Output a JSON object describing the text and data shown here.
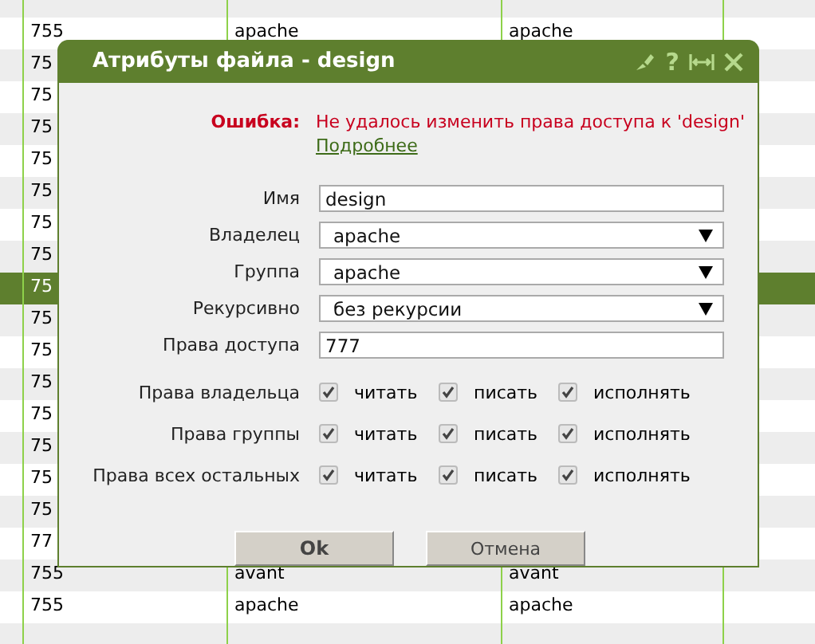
{
  "table": {
    "rows": [
      {
        "column_1": "755",
        "column_2": "apache",
        "column_3": "apache",
        "selected": false
      },
      {
        "column_1": "75",
        "selected": false
      },
      {
        "column_1": "75",
        "selected": false
      },
      {
        "column_1": "75",
        "selected": false
      },
      {
        "column_1": "75",
        "selected": false
      },
      {
        "column_1": "75",
        "selected": false
      },
      {
        "column_1": "75",
        "selected": false
      },
      {
        "column_1": "75",
        "selected": false
      },
      {
        "column_1": "75",
        "selected": true
      },
      {
        "column_1": "75",
        "selected": false
      },
      {
        "column_1": "75",
        "selected": false
      },
      {
        "column_1": "75",
        "selected": false
      },
      {
        "column_1": "75",
        "selected": false
      },
      {
        "column_1": "75",
        "selected": false
      },
      {
        "column_1": "75",
        "selected": false
      },
      {
        "column_1": "75",
        "selected": false
      },
      {
        "column_1": "77",
        "selected": false
      },
      {
        "column_1": "755",
        "column_2": "avant",
        "column_3": "avant",
        "selected": false
      },
      {
        "column_1": "755",
        "column_2": "apache",
        "column_3": "apache",
        "selected": false
      }
    ]
  },
  "dialog": {
    "title": "Атрибуты файла - design",
    "help": "?",
    "error": {
      "label": "Ошибка:",
      "message": "Не удалось изменить права доступа к 'design'",
      "link": "Подробнее"
    },
    "fields": [
      {
        "kind": "text",
        "label": "Имя",
        "value": "design"
      },
      {
        "kind": "select",
        "label": "Владелец",
        "value": "apache"
      },
      {
        "kind": "select",
        "label": "Группа",
        "value": "apache"
      },
      {
        "kind": "select",
        "label": "Рекурсивно",
        "value": "без рекурсии"
      },
      {
        "kind": "text",
        "label": "Права доступа",
        "value": "777"
      }
    ],
    "permissions": [
      {
        "label": "Права владельца",
        "options": [
          {
            "label": "читать",
            "checked": true
          },
          {
            "label": "писать",
            "checked": true
          },
          {
            "label": "исполнять",
            "checked": true
          }
        ]
      },
      {
        "label": "Права группы",
        "options": [
          {
            "label": "читать",
            "checked": true
          },
          {
            "label": "писать",
            "checked": true
          },
          {
            "label": "исполнять",
            "checked": true
          }
        ]
      },
      {
        "label": "Права всех остальных",
        "options": [
          {
            "label": "читать",
            "checked": true
          },
          {
            "label": "писать",
            "checked": true
          },
          {
            "label": "исполнять",
            "checked": true
          }
        ]
      }
    ],
    "buttons": [
      {
        "label": "Ok",
        "primary": true
      },
      {
        "label": "Отмена",
        "primary": false
      }
    ]
  }
}
